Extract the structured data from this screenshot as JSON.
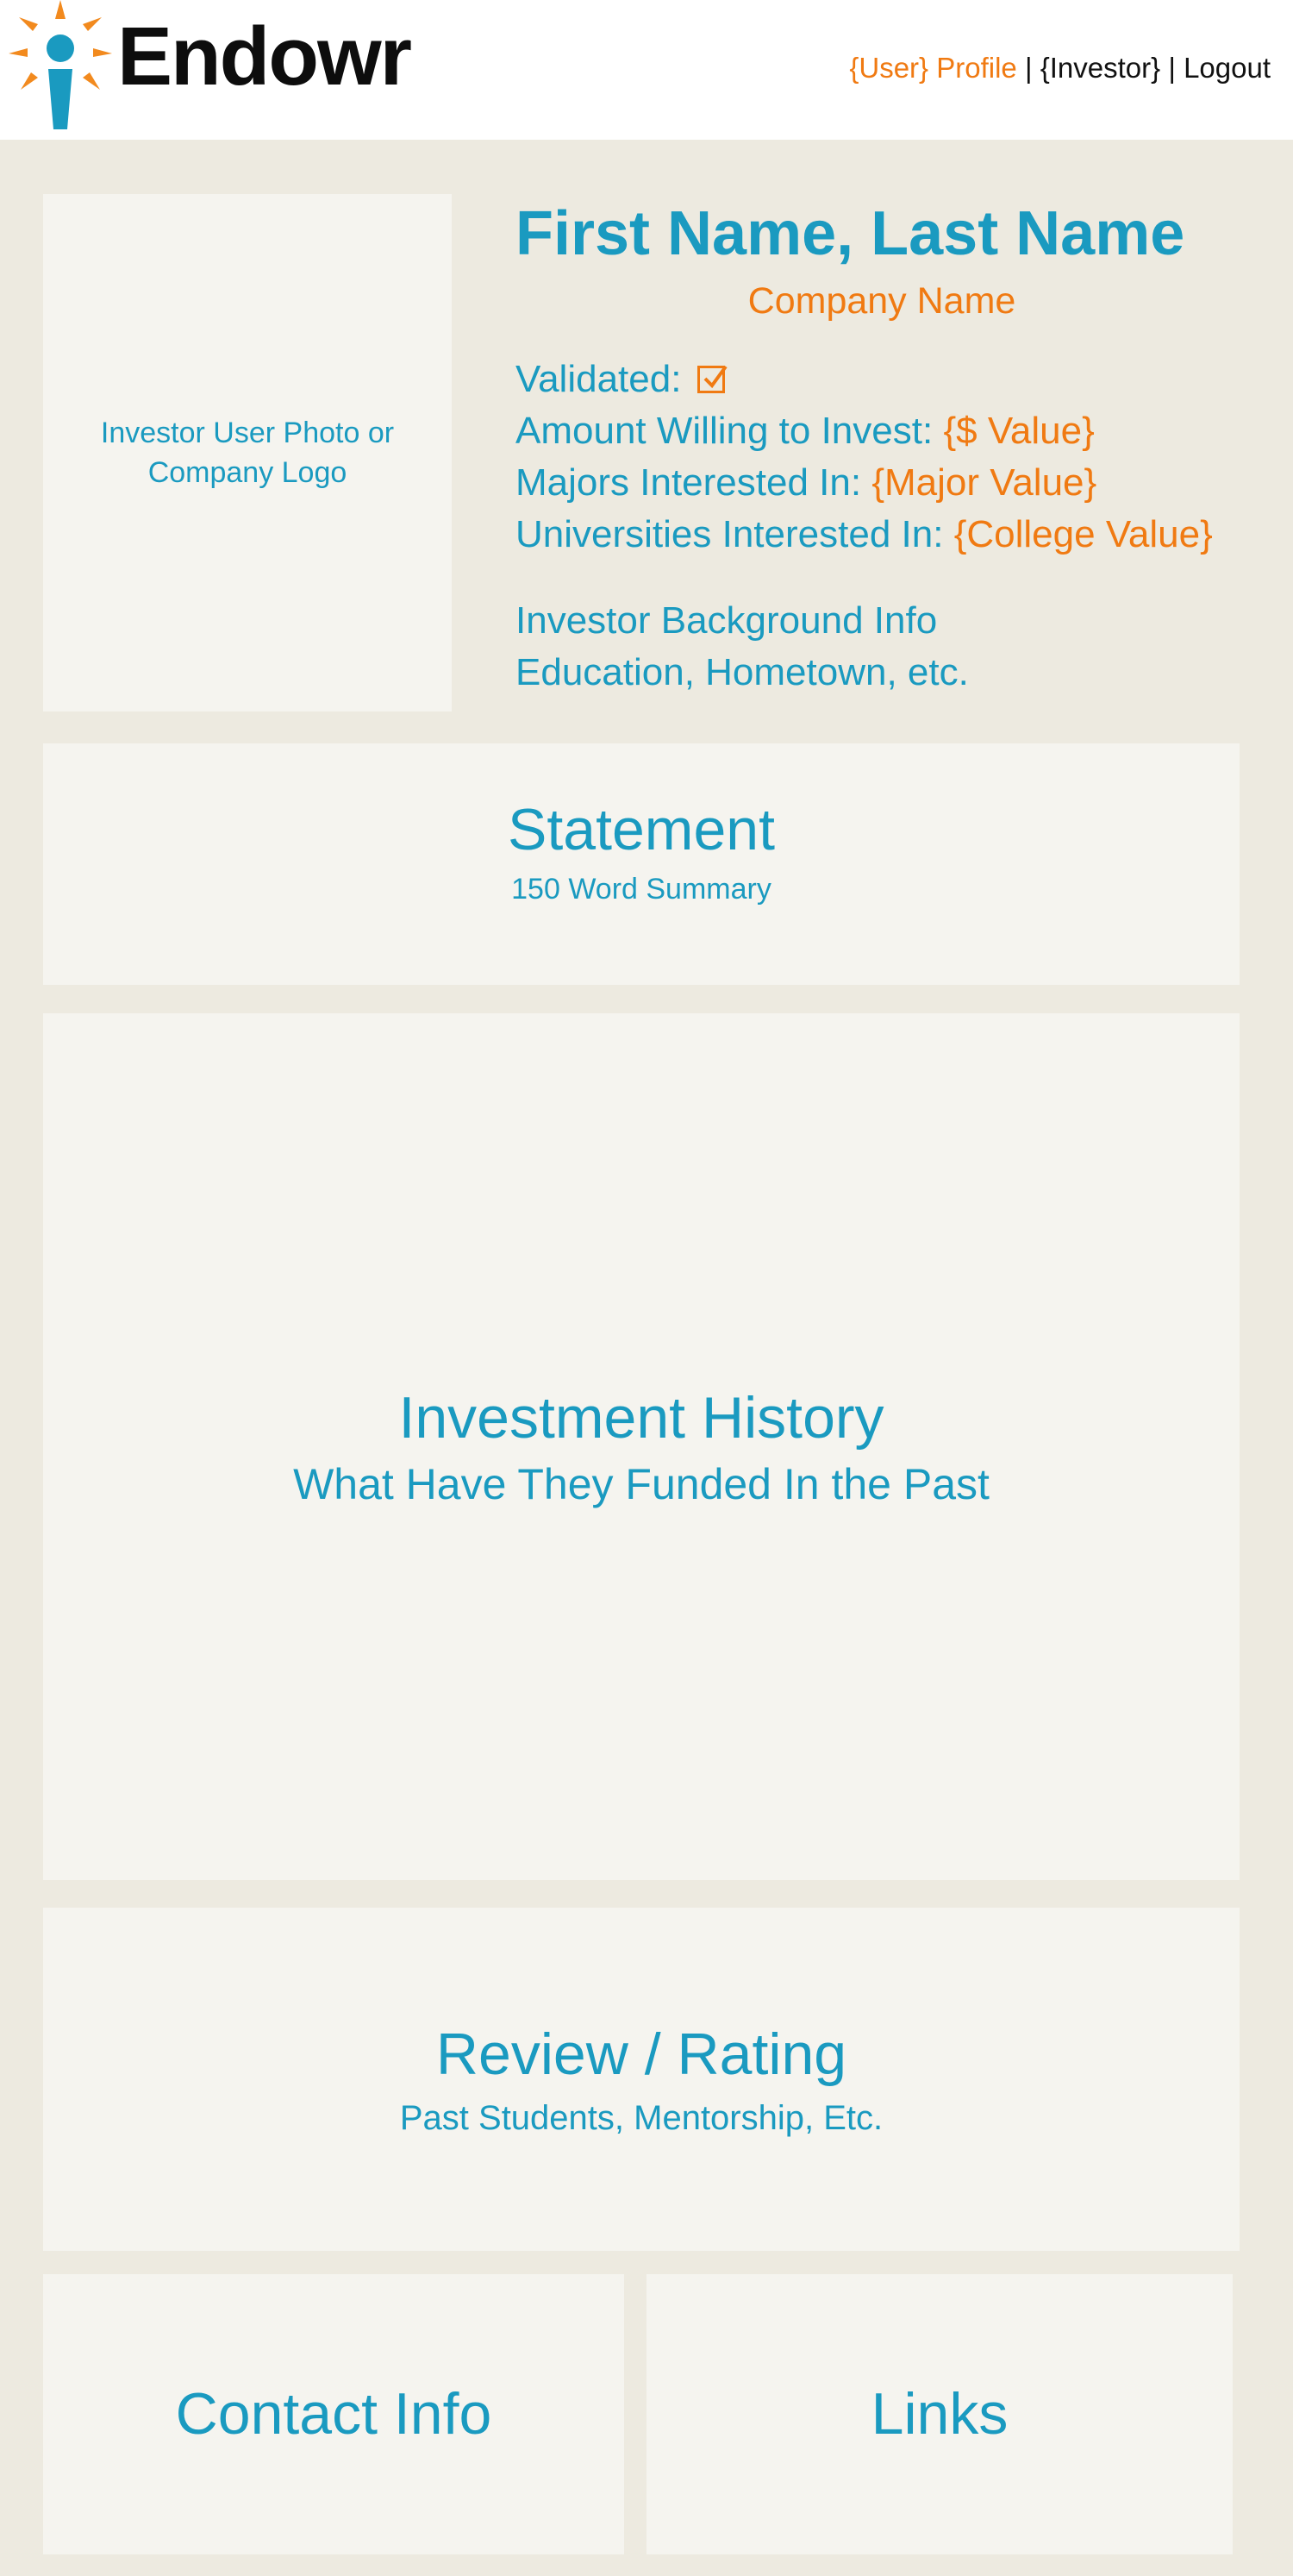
{
  "header": {
    "logo_text": "Endowr",
    "nav": {
      "user_profile": "{User} Profile",
      "separator": "|",
      "investor": "{Investor}",
      "logout": "Logout"
    }
  },
  "photo": {
    "label": "Investor User Photo or Company Logo"
  },
  "profile": {
    "name": "First Name, Last Name",
    "company": "Company Name",
    "validated_label": "Validated:",
    "validated": true,
    "amount_label": "Amount Willing to Invest:",
    "amount_value": "{$ Value}",
    "majors_label": "Majors Interested In:",
    "majors_value": "{Major Value}",
    "universities_label": "Universities Interested In:",
    "universities_value": "{College Value}",
    "background_line1": "Investor Background Info",
    "background_line2": "Education, Hometown, etc."
  },
  "statement": {
    "title": "Statement",
    "subtitle": "150 Word Summary"
  },
  "investment": {
    "title": "Investment History",
    "subtitle": "What Have They Funded In the Past"
  },
  "review": {
    "title": "Review / Rating",
    "subtitle": "Past Students, Mentorship, Etc."
  },
  "contact": {
    "title": "Contact Info"
  },
  "links": {
    "title": "Links"
  },
  "colors": {
    "accent_blue": "#1a9ac0",
    "accent_orange": "#f07a12",
    "page_bg": "#edeae0",
    "panel_bg": "#f5f4ef"
  }
}
